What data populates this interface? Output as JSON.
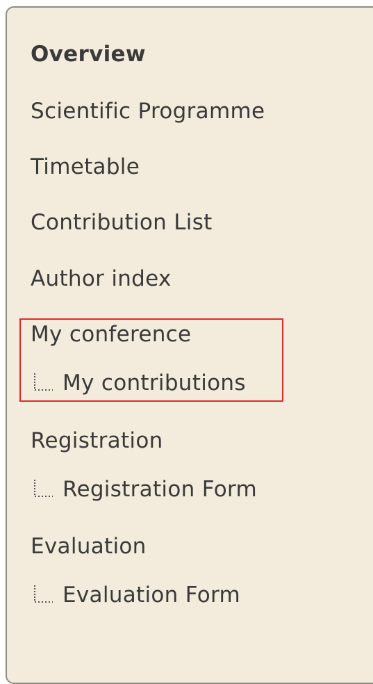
{
  "menu": {
    "items": [
      {
        "label": "Overview"
      },
      {
        "label": "Scientific Programme"
      },
      {
        "label": "Timetable"
      },
      {
        "label": "Contribution List"
      },
      {
        "label": "Author index"
      },
      {
        "label": "My conference",
        "child": "My contributions"
      },
      {
        "label": "Registration",
        "child": "Registration Form"
      },
      {
        "label": "Evaluation",
        "child": "Evaluation Form"
      }
    ]
  },
  "colors": {
    "panel_background": "#f3ecdc",
    "panel_border": "#8f8a82",
    "text": "#3a3a3a",
    "highlight_box": "#e02a2a"
  },
  "icons": {
    "submenu_connector": "tree-connector-icon"
  }
}
